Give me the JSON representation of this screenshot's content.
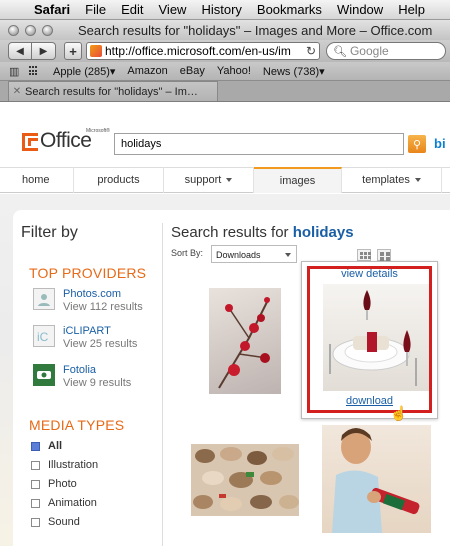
{
  "menubar": {
    "apple": "",
    "items": [
      "Safari",
      "File",
      "Edit",
      "View",
      "History",
      "Bookmarks",
      "Window",
      "Help"
    ]
  },
  "window": {
    "title": "Search results for \"holidays\" – Images and More – Office.com"
  },
  "toolbar": {
    "back_icon": "back-arrow-icon",
    "forward_icon": "forward-arrow-icon",
    "add_bookmark": "+",
    "url": "http://office.microsoft.com/en-us/im",
    "search_placeholder": "Google"
  },
  "bookmarks": {
    "items": [
      "Apple (285)▾",
      "Amazon",
      "eBay",
      "Yahoo!",
      "News (738)▾"
    ]
  },
  "tab": {
    "label": "Search results for \"holidays\" – Im…"
  },
  "office": {
    "logo_text": "Office",
    "logo_tm": "Microsoft®",
    "search_value": "holidays",
    "bing_text": "bi",
    "nav": [
      "home",
      "products",
      "support",
      "images",
      "templates"
    ],
    "active_nav": "images"
  },
  "filter": {
    "title": "Filter by",
    "providers_heading": "TOP PROVIDERS",
    "providers": [
      {
        "name": "Photos.com",
        "count": "View 112 results"
      },
      {
        "name": "iCLIPART",
        "count": "View 25 results"
      },
      {
        "name": "Fotolia",
        "count": "View 9 results"
      }
    ],
    "media_heading": "MEDIA TYPES",
    "media_types": [
      "All",
      "Illustration",
      "Photo",
      "Animation",
      "Sound"
    ],
    "selected_media": "All"
  },
  "results": {
    "title_prefix": "Search results for ",
    "query": "holidays",
    "sort_label": "Sort By:",
    "sort_value": "Downloads",
    "hover_view_details": "view details",
    "hover_download": "download"
  },
  "colors": {
    "accent_orange": "#e76a17",
    "link_blue": "#1a5fa6",
    "highlight_red": "#d41f1f"
  }
}
